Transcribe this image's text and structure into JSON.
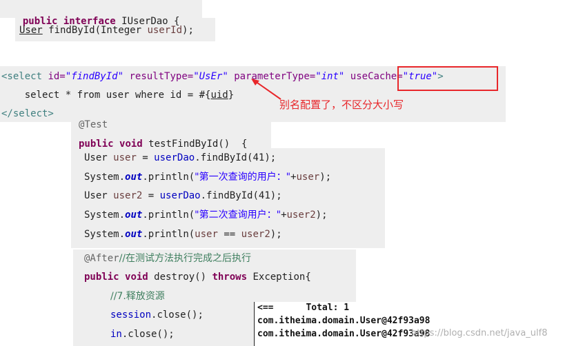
{
  "interface_block": {
    "line1": {
      "kw1": "public",
      "kw2": "interface",
      "name": "IUserDao {"
    },
    "line2": {
      "type": "User",
      "rest": " findById(Integer ",
      "param": "userId",
      "end": ");"
    }
  },
  "mapper_block": {
    "line1": {
      "open": "<select ",
      "a1": "id=",
      "v1": "\"findById\"",
      "a2": " resultType=",
      "v2": "\"UsEr\"",
      "a3": " parameterType=",
      "v3": "\"int\"",
      "a4": " useCache=",
      "v4": "\"true\"",
      "close": ">"
    },
    "line2": {
      "sql": "    select * from user where id = #{",
      "param": "uid",
      "end": "}"
    },
    "line3": {
      "close_tag": "</select>"
    }
  },
  "annotation_note": "别名配置了，不区分大小写",
  "test_block": {
    "annotation": "@Test",
    "signature": {
      "kw1": "public",
      "kw2": "void",
      "rest": " testFindById()  {"
    },
    "lines": [
      {
        "t1": "User ",
        "v1": "user",
        "t2": " = ",
        "v2": "userDao",
        "t3": ".findById(41);"
      },
      {
        "t1": "System.",
        "f": "out",
        "t2": ".println(",
        "s": "\"第一次查询的用户：\"",
        "t3": "+",
        "v": "user",
        "t4": ");"
      },
      {
        "t1": "User ",
        "v1": "user2",
        "t2": " = ",
        "v2": "userDao",
        "t3": ".findById(41);"
      },
      {
        "t1": "System.",
        "f": "out",
        "t2": ".println(",
        "s": "\"第二次查询用户：\"",
        "t3": "+",
        "v": "user2",
        "t4": ");"
      },
      {
        "t1": "System.",
        "f": "out",
        "t2": ".println(",
        "v1": "user",
        "t3": " == ",
        "v2": "user2",
        "t4": ");"
      }
    ]
  },
  "after_block": {
    "annotation": "@After",
    "annotation_comment": "//在测试方法执行完成之后执行",
    "signature": {
      "kw1": "public",
      "kw2": "void",
      "rest": " destroy() ",
      "kw3": "throws",
      "rest2": " Exception{"
    },
    "comment": "//7.释放资源",
    "line_session": {
      "v": "session",
      "rest": ".close();"
    },
    "line_in": {
      "v": "in",
      "rest": ".close();"
    }
  },
  "console": {
    "header": "<==      Total: 1",
    "lines": [
      "com.itheima.domain.User@42f93a98",
      "com.itheima.domain.User@42f93a98"
    ]
  },
  "watermark": "https://blog.csdn.net/java_ulf8",
  "colors": {
    "highlight": "#e8262a",
    "keyword": "#7f0055",
    "string": "#2a00ff",
    "field": "#0000c0"
  }
}
